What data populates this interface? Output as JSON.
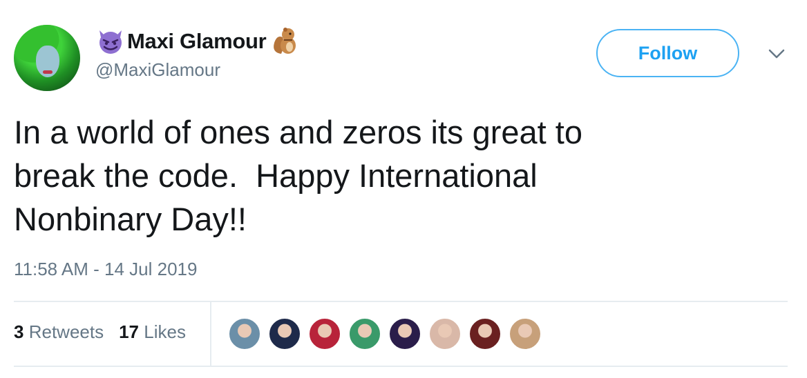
{
  "tweet": {
    "display_name": "Maxi Glamour",
    "handle": "@MaxiGlamour",
    "follow_label": "Follow",
    "text": "In a world of ones and zeros its great to\nbreak the code.  Happy International\nNonbinary Day!!",
    "timestamp": "11:58 AM - 14 Jul 2019",
    "name_emoji_left": "smiling-devil-emoji",
    "name_emoji_right": "chipmunk-emoji"
  },
  "stats": {
    "retweets_count": "3",
    "retweets_label": "Retweets",
    "likes_count": "17",
    "likes_label": "Likes"
  },
  "likers": [
    {
      "color": "#6b8fa8"
    },
    {
      "color": "#1e2a4a"
    },
    {
      "color": "#b8233a"
    },
    {
      "color": "#3a9a6a"
    },
    {
      "color": "#2a1d4a"
    },
    {
      "color": "#d9b8a8"
    },
    {
      "color": "#6a2020"
    },
    {
      "color": "#c7a07a"
    }
  ],
  "colors": {
    "accent": "#1da1f2",
    "text": "#14171a",
    "secondary": "#657786"
  }
}
